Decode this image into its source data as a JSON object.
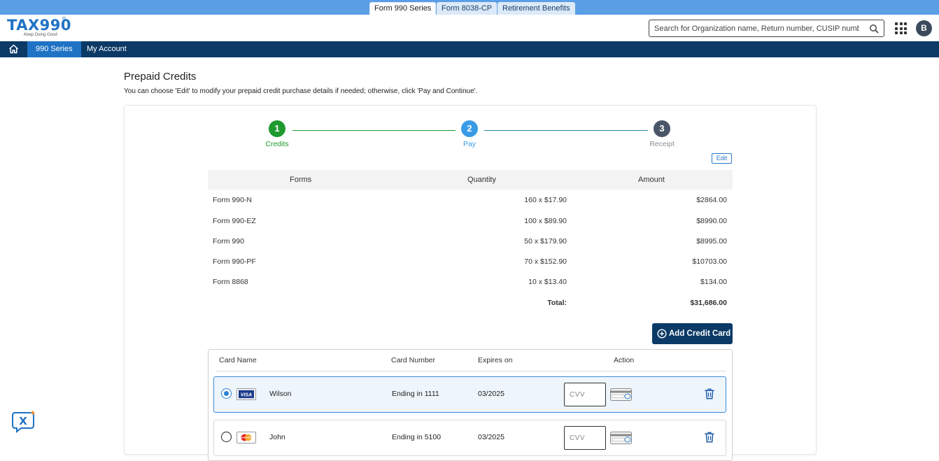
{
  "product_tabs": [
    {
      "label": "Form 990 Series",
      "active": true
    },
    {
      "label": "Form 8038-CP",
      "active": false
    },
    {
      "label": "Retirement Benefits",
      "active": false
    }
  ],
  "header": {
    "logo": {
      "text_a": "TA",
      "text_x": "X",
      "text_b": "990",
      "reg": "®",
      "tagline": "Keep Doing Good"
    },
    "search_placeholder": "Search for Organization name, Return number, CUSIP number",
    "avatar_initial": "B"
  },
  "nav": {
    "items": [
      {
        "label": "990 Series",
        "active": true
      },
      {
        "label": "My Account",
        "active": false
      }
    ]
  },
  "page": {
    "title": "Prepaid Credits",
    "subtitle": "You can choose 'Edit' to modify your prepaid credit purchase details if needed; otherwise, click 'Pay and Continue'."
  },
  "stepper": {
    "steps": [
      {
        "number": "1",
        "label": "Credits",
        "state": "complete",
        "color": "#1e9a2e"
      },
      {
        "number": "2",
        "label": "Pay",
        "state": "current",
        "color": "#3a9be6"
      },
      {
        "number": "3",
        "label": "Receipt",
        "state": "upcoming",
        "color": "#4a5568"
      }
    ]
  },
  "edit_label": "Edit",
  "credits_table": {
    "headers": {
      "forms": "Forms",
      "quantity": "Quantity",
      "amount": "Amount"
    },
    "rows": [
      {
        "form": "Form 990-N",
        "quantity": "160 x $17.90",
        "amount": "$2864.00"
      },
      {
        "form": "Form 990-EZ",
        "quantity": "100 x $89.90",
        "amount": "$8990.00"
      },
      {
        "form": "Form 990",
        "quantity": "50 x $179.90",
        "amount": "$8995.00"
      },
      {
        "form": "Form 990-PF",
        "quantity": "70 x $152.90",
        "amount": "$10703.00"
      },
      {
        "form": "Form 8868",
        "quantity": "10 x $13.40",
        "amount": "$134.00"
      }
    ],
    "total_label": "Total:",
    "total_value": "$31,686.00"
  },
  "add_card_label": "Add Credit Card",
  "cards_table": {
    "headers": {
      "name": "Card Name",
      "number": "Card Number",
      "expires": "Expires on",
      "action": "Action"
    },
    "rows": [
      {
        "brand": "VISA",
        "brand_icon": "visa-icon",
        "name": "Wilson",
        "number": "Ending in 1111",
        "expires": "03/2025",
        "cvv_placeholder": "CVV",
        "selected": true
      },
      {
        "brand": "MasterCard",
        "brand_icon": "mastercard-icon",
        "name": "John",
        "number": "Ending in 5100",
        "expires": "03/2025",
        "cvv_placeholder": "CVV",
        "selected": false
      }
    ]
  },
  "colors": {
    "top_strip": "#5a9ee6",
    "navbar": "#0b3a66",
    "nav_active": "#1f73c4",
    "primary_button": "#0b3a66",
    "step_complete": "#1e9a2e",
    "step_current": "#3a9be6",
    "step_upcoming": "#4a5568"
  }
}
